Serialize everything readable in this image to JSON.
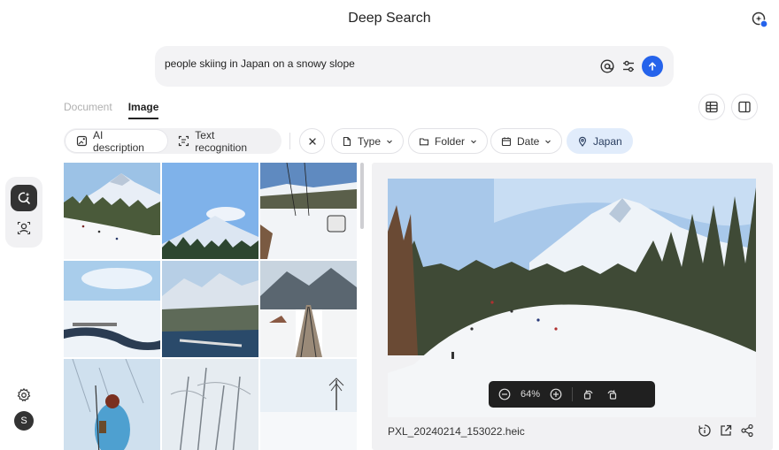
{
  "app": {
    "title": "Deep Search",
    "avatar_letter": "S",
    "accent": "#2563eb"
  },
  "search": {
    "value": "people skiing in Japan on a snowy slope"
  },
  "tabs": [
    {
      "label": "Document",
      "active": false
    },
    {
      "label": "Image",
      "active": true
    }
  ],
  "modes": [
    {
      "label": "AI description",
      "icon": "image-ai-icon",
      "active": true
    },
    {
      "label": "Text recognition",
      "icon": "text-scan-icon",
      "active": false
    }
  ],
  "filters": {
    "type": "Type",
    "folder": "Folder",
    "date": "Date",
    "location": "Japan"
  },
  "icons": [
    "search-settings-icon",
    "at-sign-icon",
    "sliders-icon",
    "send-arrow-icon",
    "table-view-icon",
    "split-view-icon",
    "image-search-icon",
    "face-search-icon",
    "gear-icon",
    "zoom-out-icon",
    "zoom-in-icon",
    "rotate-left-icon",
    "rotate-right-icon",
    "info-icon",
    "open-external-icon",
    "share-icon"
  ],
  "preview": {
    "zoom": "64%",
    "filename": "PXL_20240214_153022.heic"
  }
}
